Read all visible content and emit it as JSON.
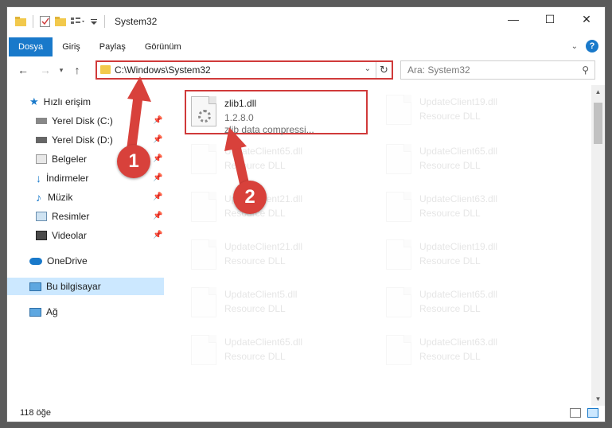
{
  "window": {
    "title": "System32"
  },
  "ribbon": {
    "tabs": [
      "Dosya",
      "Giriş",
      "Paylaş",
      "Görünüm"
    ]
  },
  "address": {
    "path": "C:\\Windows\\System32"
  },
  "search": {
    "placeholder": "Ara: System32"
  },
  "nav": {
    "items": [
      {
        "label": "Hızlı erişim",
        "icon": "star-icon"
      },
      {
        "label": "Yerel Disk (C:)",
        "icon": "drive-icon",
        "pinned": true
      },
      {
        "label": "Yerel Disk (D:)",
        "icon": "drive-icon",
        "pinned": true
      },
      {
        "label": "Belgeler",
        "icon": "documents-icon",
        "pinned": true
      },
      {
        "label": "İndirmeler",
        "icon": "download-icon",
        "pinned": true
      },
      {
        "label": "Müzik",
        "icon": "music-icon",
        "pinned": true
      },
      {
        "label": "Resimler",
        "icon": "pictures-icon",
        "pinned": true
      },
      {
        "label": "Videolar",
        "icon": "videos-icon",
        "pinned": true
      },
      {
        "label": "OneDrive",
        "icon": "cloud-icon"
      },
      {
        "label": "Bu bilgisayar",
        "icon": "computer-icon",
        "selected": true
      },
      {
        "label": "Ağ",
        "icon": "network-icon"
      }
    ]
  },
  "files": {
    "highlighted": {
      "name": "zlib1.dll",
      "version": "1.2.8.0",
      "description": "zlib data compressi..."
    },
    "ghost": [
      {
        "name": "UpdateClient19.dll",
        "type": "Resource DLL"
      },
      {
        "name": "UpdateClient65.dll",
        "type": "Resource DLL"
      },
      {
        "name": "UpdateClient65.dll",
        "type": "Resource DLL"
      },
      {
        "name": "UpdateClient21.dll",
        "type": "Resource DLL"
      },
      {
        "name": "UpdateClient63.dll",
        "type": "Resource DLL"
      },
      {
        "name": "UpdateClient21.dll",
        "type": "Resource DLL"
      },
      {
        "name": "UpdateClient19.dll",
        "type": "Resource DLL"
      },
      {
        "name": "UpdateClient5.dll",
        "type": "Resource DLL"
      },
      {
        "name": "UpdateClient65.dll",
        "type": "Resource DLL"
      },
      {
        "name": "UpdateClient65.dll",
        "type": "Resource DLL"
      },
      {
        "name": "UpdateClient63.dll",
        "type": "Resource DLL"
      }
    ]
  },
  "status": {
    "count": "118 öğe"
  },
  "annotations": {
    "step1": "1",
    "step2": "2"
  },
  "colors": {
    "accent": "#1979ca",
    "highlight": "#d03a3a",
    "badge": "#d8413b"
  }
}
